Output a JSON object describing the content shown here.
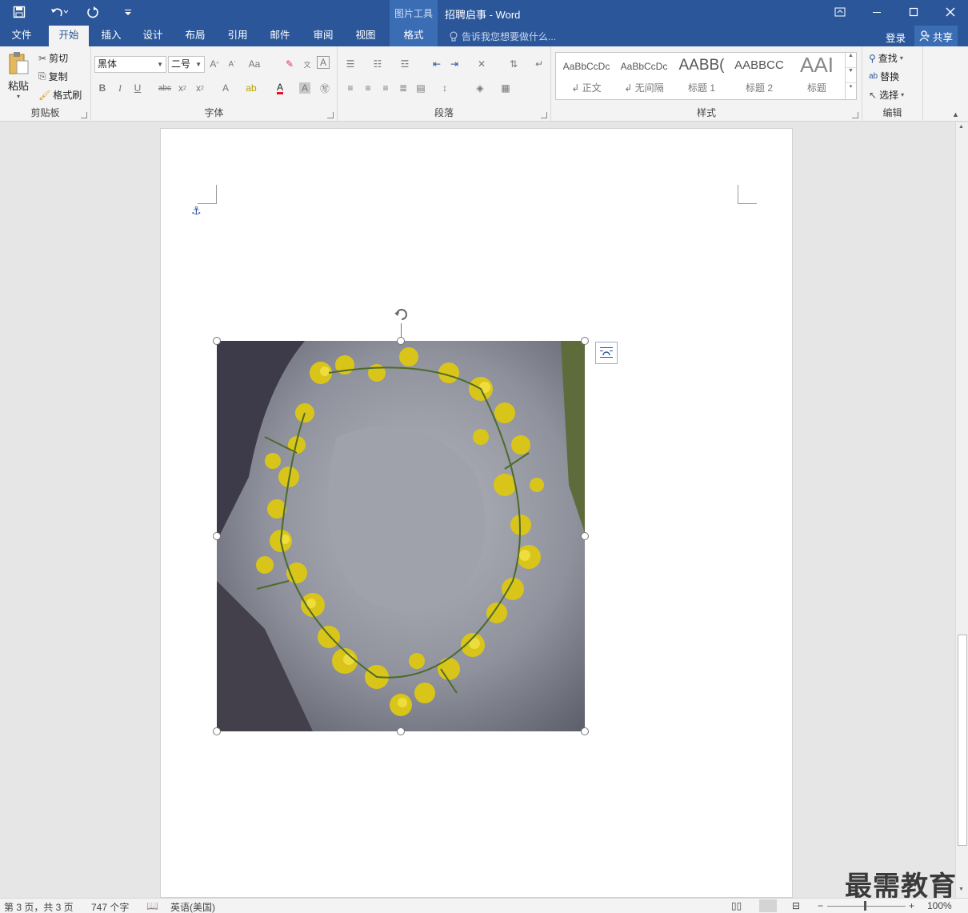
{
  "titlebar": {
    "context_label": "图片工具",
    "document_title": "招聘启事 - Word"
  },
  "tabs": [
    {
      "label": "文件"
    },
    {
      "label": "开始"
    },
    {
      "label": "插入"
    },
    {
      "label": "设计"
    },
    {
      "label": "布局"
    },
    {
      "label": "引用"
    },
    {
      "label": "邮件"
    },
    {
      "label": "审阅"
    },
    {
      "label": "视图"
    },
    {
      "label": "格式"
    }
  ],
  "tell_me": "告诉我您想要做什么...",
  "account": {
    "login": "登录",
    "share": "共享"
  },
  "clipboard": {
    "paste": "粘贴",
    "cut": "剪切",
    "copy": "复制",
    "format_painter": "格式刷",
    "label": "剪贴板"
  },
  "font": {
    "name": "黑体",
    "size": "二号",
    "label": "字体",
    "color_accent": "#e81123"
  },
  "paragraph": {
    "label": "段落"
  },
  "styles": {
    "items": [
      {
        "sample": "AaBbCcDc",
        "name": "↲ 正文"
      },
      {
        "sample": "AaBbCcDc",
        "name": "↲ 无间隔"
      },
      {
        "sample": "AABB(",
        "name": "标题 1"
      },
      {
        "sample": "AABBCC",
        "name": "标题 2"
      },
      {
        "sample": "AAI",
        "name": "标题"
      }
    ],
    "label": "样式"
  },
  "editing": {
    "find": "查找",
    "replace": "替换",
    "select": "选择",
    "label": "编辑"
  },
  "status": {
    "page": "第 3 页，共 3 页",
    "words": "747 个字",
    "language": "英语(美国)",
    "zoom": "100%"
  },
  "watermark": "最需教育",
  "colors": {
    "brand": "#2b579a",
    "ribbon": "#f3f3f3"
  }
}
